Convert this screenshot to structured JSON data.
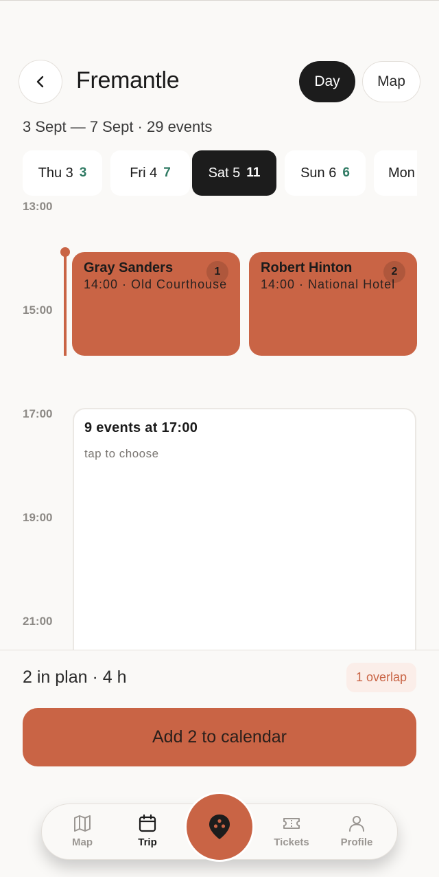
{
  "header": {
    "title": "Fremantle",
    "toggle": {
      "day_label": "Day",
      "map_label": "Map",
      "selected": "Day"
    }
  },
  "subtitle": "3 Sept — 7 Sept · 29 events",
  "days": [
    {
      "label": "Thu 3",
      "count": "3"
    },
    {
      "label": "Fri 4",
      "count": "7"
    },
    {
      "label": "Sat 5",
      "count": "11",
      "selected": true
    },
    {
      "label": "Sun 6",
      "count": "6"
    },
    {
      "label": "Mon",
      "count": ""
    }
  ],
  "timeline": {
    "hours": [
      "13:00",
      "15:00",
      "17:00",
      "19:00",
      "21:00"
    ],
    "events": [
      {
        "name": "Gray Sanders",
        "meta": "14:00 · Old Courthouse",
        "badge": "1"
      },
      {
        "name": "Robert Hinton",
        "meta": "14:00 · National Hotel",
        "badge": "2"
      }
    ],
    "group": {
      "title": "9 events at 17:00",
      "hint": "tap to choose"
    }
  },
  "plan": {
    "summary": "2 in plan · 4 h",
    "overlap": "1 overlap",
    "cta": "Add 2 to calendar"
  },
  "tabbar": {
    "tabs": [
      {
        "label": "Map",
        "icon": "map-icon"
      },
      {
        "label": "Trip",
        "icon": "calendar-icon",
        "active": true
      },
      {
        "label": "Tickets",
        "icon": "ticket-icon"
      },
      {
        "label": "Profile",
        "icon": "person-icon"
      }
    ],
    "center_icon": "location-pin-icon"
  },
  "colors": {
    "accent": "#c96445",
    "dark": "#1c1c1c",
    "count_green": "#2f7a63",
    "background": "#faf9f7"
  }
}
